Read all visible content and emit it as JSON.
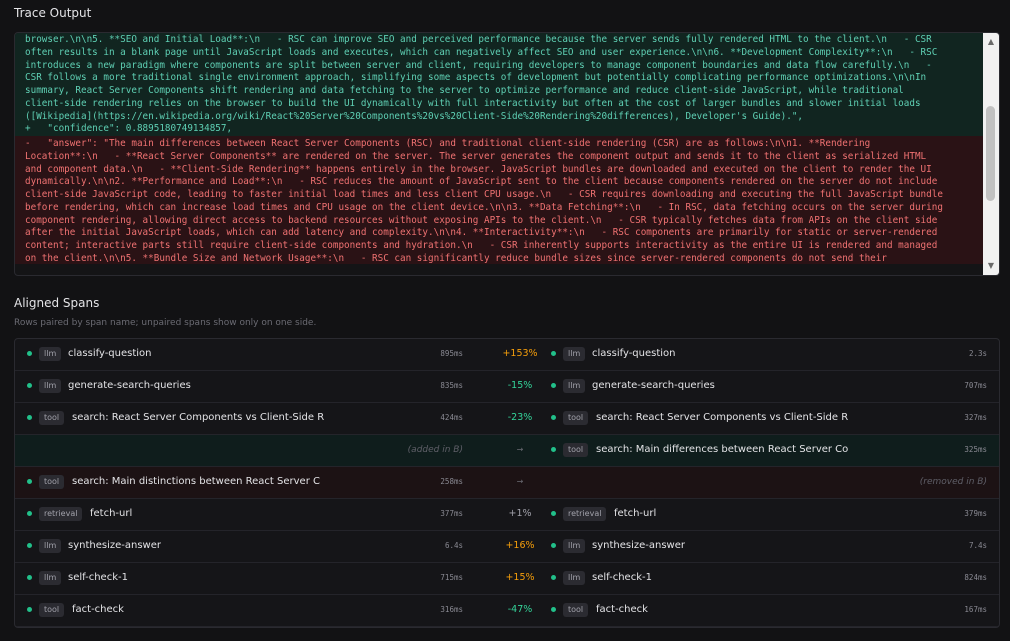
{
  "trace_output": {
    "title": "Trace Output",
    "added_lines": [
      "browser.\\n\\n5. **SEO and Initial Load**:\\n   - RSC can improve SEO and perceived performance because the server sends fully rendered HTML to the client.\\n   - CSR",
      "often results in a blank page until JavaScript loads and executes, which can negatively affect SEO and user experience.\\n\\n6. **Development Complexity**:\\n   - RSC",
      "introduces a new paradigm where components are split between server and client, requiring developers to manage component boundaries and data flow carefully.\\n   -",
      "CSR follows a more traditional single environment approach, simplifying some aspects of development but potentially complicating performance optimizations.\\n\\nIn",
      "summary, React Server Components shift rendering and data fetching to the server to optimize performance and reduce client-side JavaScript, while traditional",
      "client-side rendering relies on the browser to build the UI dynamically with full interactivity but often at the cost of larger bundles and slower initial loads",
      "([Wikipedia](https://en.wikipedia.org/wiki/React%20Server%20Components%20vs%20Client-Side%20Rendering%20differences), Developer's Guide).\",",
      "+   \"confidence\": 0.8895180749134857,"
    ],
    "removed_lines": [
      "-   \"answer\": \"The main differences between React Server Components (RSC) and traditional client-side rendering (CSR) are as follows:\\n\\n1. **Rendering",
      "Location**:\\n   - **React Server Components** are rendered on the server. The server generates the component output and sends it to the client as serialized HTML",
      "and component data.\\n   - **Client-Side Rendering** happens entirely in the browser. JavaScript bundles are downloaded and executed on the client to render the UI",
      "dynamically.\\n\\n2. **Performance and Load**:\\n   - RSC reduces the amount of JavaScript sent to the client because components rendered on the server do not include",
      "client-side JavaScript code, leading to faster initial load times and less client CPU usage.\\n   - CSR requires downloading and executing the full JavaScript bundle",
      "before rendering, which can increase load times and CPU usage on the client device.\\n\\n3. **Data Fetching**:\\n   - In RSC, data fetching occurs on the server during",
      "component rendering, allowing direct access to backend resources without exposing APIs to the client.\\n   - CSR typically fetches data from APIs on the client side",
      "after the initial JavaScript loads, which can add latency and complexity.\\n\\n4. **Interactivity**:\\n   - RSC components are primarily for static or server-rendered",
      "content; interactive parts still require client-side components and hydration.\\n   - CSR inherently supports interactivity as the entire UI is rendered and managed",
      "on the client.\\n\\n5. **Bundle Size and Network Usage**:\\n   - RSC can significantly reduce bundle sizes since server-rendered components do not send their"
    ]
  },
  "aligned_spans": {
    "title": "Aligned Spans",
    "subtitle": "Rows paired by span name; unpaired spans show only on one side.",
    "rows": [
      {
        "a": {
          "type": "llm",
          "name": "classify-question",
          "duration": "895ms"
        },
        "delta": "+153%",
        "delta_kind": "up",
        "b": {
          "type": "llm",
          "name": "classify-question",
          "duration": "2.3s"
        }
      },
      {
        "a": {
          "type": "llm",
          "name": "generate-search-queries",
          "duration": "835ms"
        },
        "delta": "-15%",
        "delta_kind": "down",
        "b": {
          "type": "llm",
          "name": "generate-search-queries",
          "duration": "707ms"
        }
      },
      {
        "a": {
          "type": "tool",
          "name": "search: React Server Components vs Client-Side R",
          "duration": "424ms"
        },
        "delta": "-23%",
        "delta_kind": "down",
        "b": {
          "type": "tool",
          "name": "search: React Server Components vs Client-Side R",
          "duration": "327ms"
        }
      },
      {
        "kind": "added",
        "a_note": "(added in B)",
        "delta": "→",
        "delta_kind": "arrow",
        "b": {
          "type": "tool",
          "name": "search: Main differences between React Server Co",
          "duration": "325ms"
        }
      },
      {
        "kind": "removed",
        "a": {
          "type": "tool",
          "name": "search: Main distinctions between React Server C",
          "duration": "258ms"
        },
        "delta": "→",
        "delta_kind": "arrow",
        "b_note": "(removed in B)"
      },
      {
        "a": {
          "type": "retrieval",
          "name": "fetch-url",
          "duration": "377ms"
        },
        "delta": "+1%",
        "delta_kind": "neutral",
        "b": {
          "type": "retrieval",
          "name": "fetch-url",
          "duration": "379ms"
        }
      },
      {
        "a": {
          "type": "llm",
          "name": "synthesize-answer",
          "duration": "6.4s"
        },
        "delta": "+16%",
        "delta_kind": "up",
        "b": {
          "type": "llm",
          "name": "synthesize-answer",
          "duration": "7.4s"
        }
      },
      {
        "a": {
          "type": "llm",
          "name": "self-check-1",
          "duration": "715ms"
        },
        "delta": "+15%",
        "delta_kind": "up",
        "b": {
          "type": "llm",
          "name": "self-check-1",
          "duration": "824ms"
        }
      },
      {
        "a": {
          "type": "tool",
          "name": "fact-check",
          "duration": "316ms"
        },
        "delta": "-47%",
        "delta_kind": "down",
        "b": {
          "type": "tool",
          "name": "fact-check",
          "duration": "167ms"
        }
      }
    ]
  },
  "colors": {
    "background": "#121214",
    "added_bg": "#112520",
    "added_text": "#5fd0b4",
    "removed_bg": "#2a1215",
    "removed_text": "#f07272",
    "status_dot": "#22c08a",
    "delta_up": "#f59e0b",
    "delta_down": "#34d399"
  },
  "icons": {
    "status": "status-dot-icon",
    "scroll_up": "scroll-up-arrow-icon",
    "scroll_down": "scroll-down-arrow-icon"
  }
}
